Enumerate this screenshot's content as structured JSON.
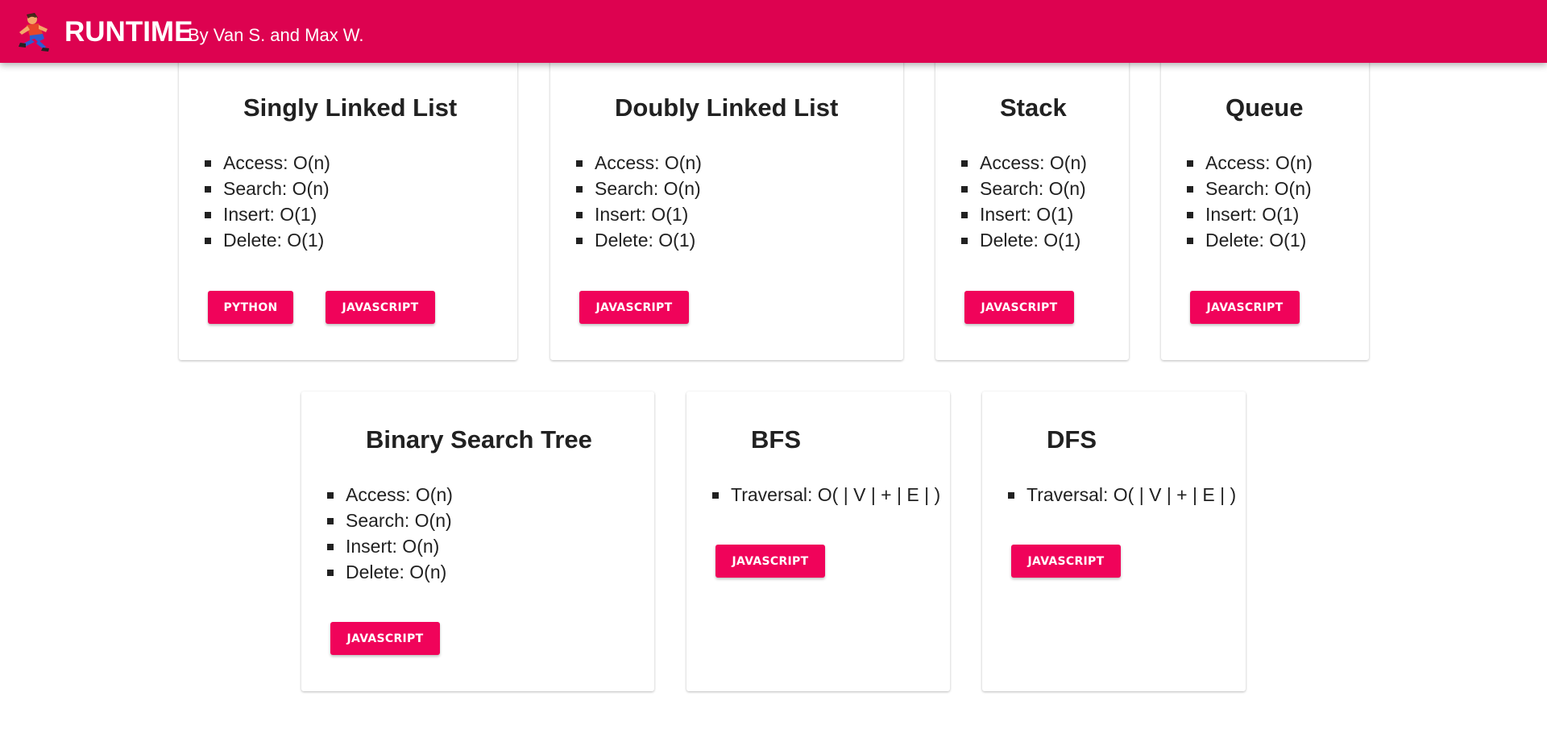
{
  "header": {
    "brand": "RUNTIME",
    "byline": "By Van S. and Max W.",
    "logo_icon": "running-person-icon",
    "bar_color": "#dd0250"
  },
  "accent_color": "#f0035a",
  "cards": [
    {
      "title": "Singly Linked List",
      "ops": [
        "Access: O(n)",
        "Search: O(n)",
        "Insert: O(1)",
        "Delete: O(1)"
      ],
      "buttons": [
        "PYTHON",
        "JAVASCRIPT"
      ]
    },
    {
      "title": "Doubly Linked List",
      "ops": [
        "Access: O(n)",
        "Search: O(n)",
        "Insert: O(1)",
        "Delete: O(1)"
      ],
      "buttons": [
        "JAVASCRIPT"
      ]
    },
    {
      "title": "Stack",
      "ops": [
        "Access: O(n)",
        "Search: O(n)",
        "Insert: O(1)",
        "Delete: O(1)"
      ],
      "buttons": [
        "JAVASCRIPT"
      ]
    },
    {
      "title": "Queue",
      "ops": [
        "Access: O(n)",
        "Search: O(n)",
        "Insert: O(1)",
        "Delete: O(1)"
      ],
      "buttons": [
        "JAVASCRIPT"
      ]
    },
    {
      "title": "Binary Search Tree",
      "ops": [
        "Access: O(n)",
        "Search: O(n)",
        "Insert: O(n)",
        "Delete: O(n)"
      ],
      "buttons": [
        "JAVASCRIPT"
      ]
    },
    {
      "title": "BFS",
      "ops": [
        "Traversal: O( | V | + | E | )"
      ],
      "buttons": [
        "JAVASCRIPT"
      ]
    },
    {
      "title": "DFS",
      "ops": [
        "Traversal: O( | V | + | E | )"
      ],
      "buttons": [
        "JAVASCRIPT"
      ]
    }
  ]
}
